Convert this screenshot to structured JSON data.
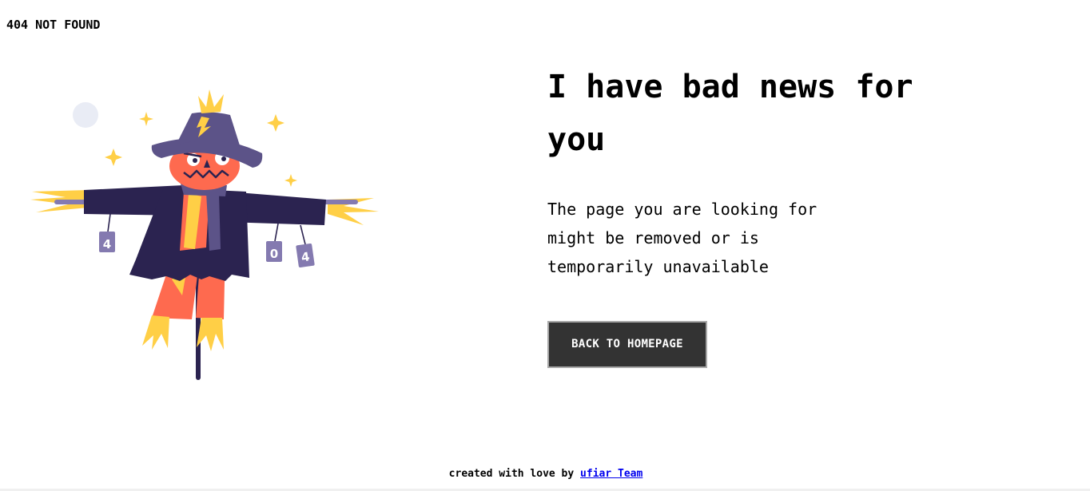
{
  "header": {
    "brand": "404 NOT FOUND"
  },
  "main": {
    "headline": "I have bad news for you",
    "message": "The page you are looking for might be removed or is temporarily unavailable",
    "cta_label": "BACK TO HOMEPAGE"
  },
  "illustration": {
    "name": "scarecrow-404-illustration",
    "can_labels": [
      "4",
      "0",
      "4"
    ]
  },
  "footer": {
    "prefix": "created with love by",
    "link_text": "ufiar Team"
  },
  "colors": {
    "background": "#ffffff",
    "button_bg": "#333333",
    "button_text": "#ffffff",
    "link": "#0000ee",
    "scarecrow_coat": "#2b2350",
    "scarecrow_hat": "#5c5388",
    "scarecrow_face": "#fe6a4f",
    "straw": "#ffcf46",
    "can": "#847ab0"
  }
}
